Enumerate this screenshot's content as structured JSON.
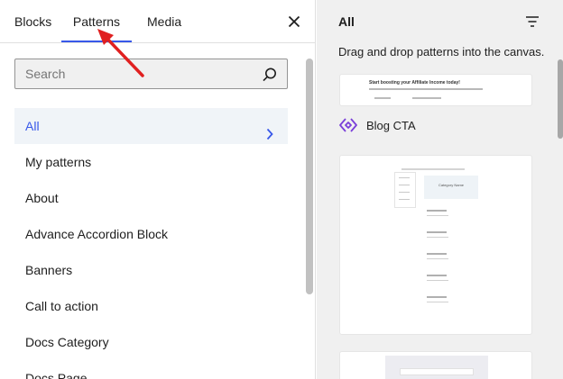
{
  "inserter": {
    "tabs": [
      {
        "label": "Blocks"
      },
      {
        "label": "Patterns"
      },
      {
        "label": "Media"
      }
    ],
    "active_tab": "Patterns",
    "close_icon": "close-icon",
    "search": {
      "placeholder": "Search",
      "value": "",
      "icon": "search-icon"
    },
    "categories": [
      {
        "label": "All",
        "active": true
      },
      {
        "label": "My patterns"
      },
      {
        "label": "About"
      },
      {
        "label": "Advance Accordion Block"
      },
      {
        "label": "Banners"
      },
      {
        "label": "Call to action"
      },
      {
        "label": "Docs Category"
      },
      {
        "label": "Docs Page"
      }
    ]
  },
  "preview": {
    "title": "All",
    "filter_icon": "filter-icon",
    "description": "Drag and drop patterns into the canvas.",
    "patterns": [
      {
        "name": "",
        "thumb_heading": "Start boosting your Affiliate Income today!"
      },
      {
        "name": "Blog CTA",
        "icon": "blog-cta-icon"
      },
      {
        "name": "",
        "thumb_heading": "Category Name"
      },
      {
        "name": ""
      }
    ]
  },
  "colors": {
    "accent": "#3858e9",
    "annotation": "#e02020"
  }
}
